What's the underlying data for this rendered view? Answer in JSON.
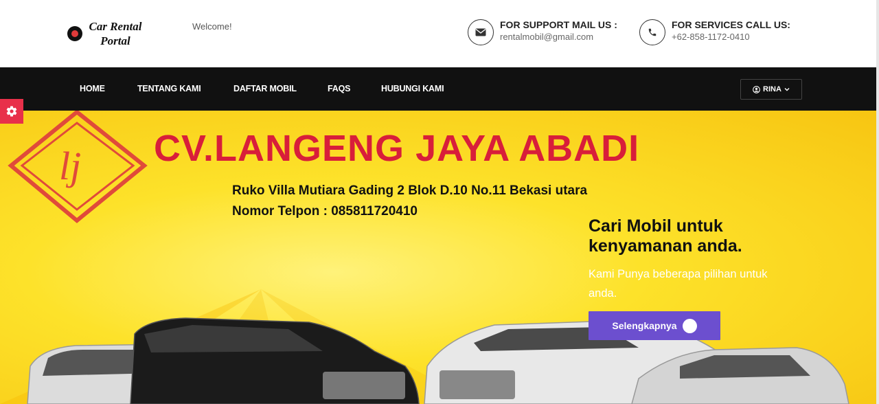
{
  "header": {
    "logo_line1": "Car Rental",
    "logo_line2": "Portal",
    "welcome": "Welcome!",
    "support": {
      "title": "FOR SUPPORT MAIL US :",
      "value": "rentalmobil@gmail.com",
      "icon": "envelope-icon"
    },
    "services": {
      "title": "FOR SERVICES CALL US:",
      "value": "+62-858-1172-0410",
      "icon": "phone-icon"
    }
  },
  "nav": {
    "items": [
      {
        "label": "HOME"
      },
      {
        "label": "TENTANG KAMI"
      },
      {
        "label": "DAFTAR MOBIL"
      },
      {
        "label": "FAQS"
      },
      {
        "label": "HUBUNGI KAMI"
      }
    ],
    "user_label": "RINA"
  },
  "hero": {
    "company": "CV.LANGENG JAYA ABADI",
    "address": "Ruko Villa Mutiara Gading 2 Blok D.10 No.11 Bekasi utara",
    "phone": "Nomor Telpon :  085811720410",
    "title": "Cari Mobil untuk kenyamanan anda.",
    "subtitle": "Kami Punya beberapa pilihan untuk anda.",
    "cta_label": "Selengkapnya"
  },
  "colors": {
    "navbar": "#111111",
    "accent_red": "#d81e3a",
    "cta_purple": "#6c4fcf",
    "hero_yellow": "#fde22a"
  }
}
